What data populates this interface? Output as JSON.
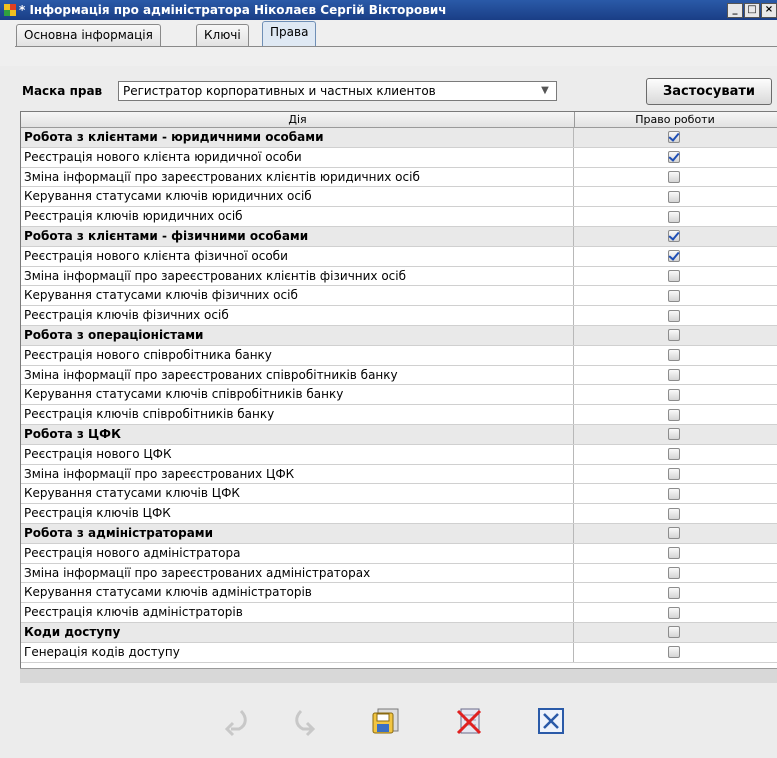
{
  "window": {
    "title": "* Інформація про адміністратора Ніколаєв Сергій Вікторович"
  },
  "tabs": [
    {
      "label": "Основна інформація",
      "active": false
    },
    {
      "label": "Ключі",
      "active": false
    },
    {
      "label": "Права",
      "active": true
    }
  ],
  "mask": {
    "label": "Маска прав",
    "value": "Регистратор корпоративных и частных клиентов",
    "apply_label": "Застосувати"
  },
  "table": {
    "columns": [
      "Дія",
      "Право роботи"
    ],
    "rows": [
      {
        "action": "Робота з клієнтами - юридичними особами",
        "group": true,
        "checked": true
      },
      {
        "action": "Реєстрація нового клієнта юридичної особи",
        "group": false,
        "checked": true
      },
      {
        "action": "Зміна інформації про зареєстрованих клієнтів юридичних осіб",
        "group": false,
        "checked": false
      },
      {
        "action": "Керування статусами ключів юридичних осіб",
        "group": false,
        "checked": false
      },
      {
        "action": "Реєстрація ключів юридичних осіб",
        "group": false,
        "checked": false
      },
      {
        "action": "Робота з клієнтами - фізичними особами",
        "group": true,
        "checked": true
      },
      {
        "action": "Реєстрація нового клієнта фізичної особи",
        "group": false,
        "checked": true
      },
      {
        "action": "Зміна інформації про зареєстрованих клієнтів фізичних осіб",
        "group": false,
        "checked": false
      },
      {
        "action": "Керування статусами ключів фізичних осіб",
        "group": false,
        "checked": false
      },
      {
        "action": "Реєстрація ключів фізичних осіб",
        "group": false,
        "checked": false
      },
      {
        "action": "Робота з операціоністами",
        "group": true,
        "checked": false
      },
      {
        "action": "Реєстрація нового співробітника банку",
        "group": false,
        "checked": false
      },
      {
        "action": "Зміна інформації про зареєстрованих співробітників банку",
        "group": false,
        "checked": false
      },
      {
        "action": "Керування статусами ключів співробітників банку",
        "group": false,
        "checked": false
      },
      {
        "action": "Реєстрація ключів співробітників банку",
        "group": false,
        "checked": false
      },
      {
        "action": "Робота з ЦФК",
        "group": true,
        "checked": false
      },
      {
        "action": "Реєстрація нового ЦФК",
        "group": false,
        "checked": false
      },
      {
        "action": "Зміна інформації про зареєстрованих ЦФК",
        "group": false,
        "checked": false
      },
      {
        "action": "Керування статусами ключів ЦФК",
        "group": false,
        "checked": false
      },
      {
        "action": "Реєстрація ключів ЦФК",
        "group": false,
        "checked": false
      },
      {
        "action": "Робота з адміністраторами",
        "group": true,
        "checked": false
      },
      {
        "action": "Реєстрація нового адміністратора",
        "group": false,
        "checked": false
      },
      {
        "action": "Зміна інформації про зареєстрованих адміністраторах",
        "group": false,
        "checked": false
      },
      {
        "action": "Керування статусами ключів адміністраторів",
        "group": false,
        "checked": false
      },
      {
        "action": "Реєстрація ключів адміністраторів",
        "group": false,
        "checked": false
      },
      {
        "action": "Коди доступу",
        "group": true,
        "checked": false
      },
      {
        "action": "Генерація кодів доступу",
        "group": false,
        "checked": false
      }
    ]
  },
  "toolbar": [
    {
      "icon": "redo-icon",
      "enabled": false
    },
    {
      "icon": "undo-icon",
      "enabled": false
    },
    {
      "icon": "save-icon",
      "enabled": true
    },
    {
      "icon": "delete-icon",
      "enabled": true
    },
    {
      "icon": "close-icon",
      "enabled": true
    }
  ]
}
